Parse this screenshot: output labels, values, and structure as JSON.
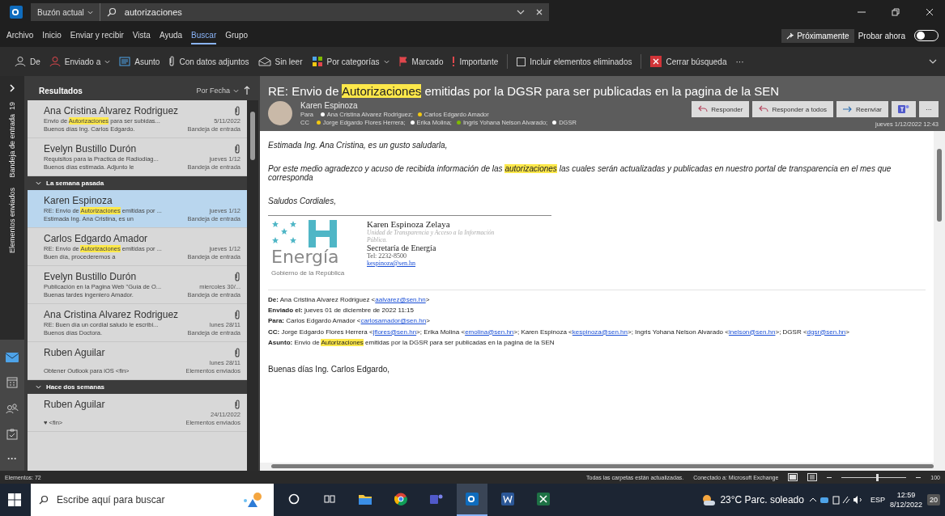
{
  "title_bar": {
    "scope": "Buzón actual",
    "search_value": "autorizaciones"
  },
  "menu_tabs": [
    {
      "label": "Archivo",
      "selected": false
    },
    {
      "label": "Inicio",
      "selected": false
    },
    {
      "label": "Enviar y recibir",
      "selected": false
    },
    {
      "label": "Vista",
      "selected": false
    },
    {
      "label": "Ayuda",
      "selected": false
    },
    {
      "label": "Buscar",
      "selected": true
    },
    {
      "label": "Grupo",
      "selected": false
    }
  ],
  "coming_soon": "Próximamente",
  "try_now": {
    "label": "Probar ahora",
    "on": false
  },
  "ribbon": [
    {
      "kind": "button",
      "label": "De",
      "dropdown": false
    },
    {
      "kind": "button",
      "label": "Enviado a",
      "dropdown": true
    },
    {
      "kind": "button",
      "label": "Asunto",
      "dropdown": false
    },
    {
      "kind": "button",
      "label": "Con datos adjuntos",
      "dropdown": false
    },
    {
      "kind": "button",
      "label": "Sin leer",
      "dropdown": false
    },
    {
      "kind": "button",
      "label": "Por categorías",
      "dropdown": true
    },
    {
      "kind": "button",
      "label": "Marcado",
      "dropdown": false
    },
    {
      "kind": "button",
      "label": "Importante",
      "dropdown": false
    },
    {
      "kind": "checkbox",
      "label": "Incluir elementos eliminados",
      "checked": false
    },
    {
      "kind": "button",
      "label": "Cerrar búsqueda",
      "dropdown": false
    },
    {
      "kind": "more",
      "label": "···"
    }
  ],
  "nav": {
    "folders": [
      {
        "label": "Bandeja de entrada",
        "count": "19"
      },
      {
        "label": "Elementos enviados"
      }
    ],
    "apps": [
      {
        "selected": true
      },
      {
        "selected": false
      },
      {
        "selected": false
      },
      {
        "selected": false
      }
    ],
    "more": "···"
  },
  "mail_list": {
    "heading": "Resultados",
    "sort": "Por Fecha",
    "items": [
      {
        "kind": "mail",
        "sender": "Ana Cristina Alvarez Rodriguez",
        "subject": [
          {
            "text": "Envio de "
          },
          {
            "text": "Autorizaciones",
            "highlight": true
          },
          {
            "text": " para ser subidas..."
          }
        ],
        "date": "5/11/2022",
        "preview": "Buenos días Ing. Carlos Edgardo.",
        "folder": "Bandeja de entrada",
        "attachment": true,
        "selected": false
      },
      {
        "kind": "mail",
        "sender": "Evelyn Bustillo Durón",
        "subject": [
          {
            "text": "Requisitos para la Practica de Radiodiag..."
          }
        ],
        "date": "jueves 1/12",
        "preview": "Buenos días estimada.  Adjunto le",
        "folder": "Bandeja de entrada",
        "attachment": true,
        "selected": false
      },
      {
        "kind": "header",
        "label": "La semana pasada"
      },
      {
        "kind": "mail",
        "sender": "Karen Espinoza",
        "subject": [
          {
            "text": "RE: Envio de "
          },
          {
            "text": "Autorizaciones",
            "highlight": true
          },
          {
            "text": " emitidas por ..."
          }
        ],
        "date": "jueves 1/12",
        "preview": "Estimada Ing. Ana Cristina, es un",
        "folder": "Bandeja de entrada",
        "attachment": false,
        "selected": true
      },
      {
        "kind": "mail",
        "sender": "Carlos Edgardo Amador",
        "subject": [
          {
            "text": "RE: Envio de "
          },
          {
            "text": "Autorizaciones",
            "highlight": true
          },
          {
            "text": " emitidas por ..."
          }
        ],
        "date": "jueves 1/12",
        "preview": "Buen día, procederemos a",
        "folder": "Bandeja de entrada",
        "attachment": false,
        "selected": false
      },
      {
        "kind": "mail",
        "sender": "Evelyn Bustillo Durón",
        "subject": [
          {
            "text": "Publicación en la Pagina Web \"Guía de O..."
          }
        ],
        "date": "miercoles 30/...",
        "preview": "Buenas tardes ingeniero Amador.",
        "folder": "Bandeja de entrada",
        "attachment": true,
        "selected": false
      },
      {
        "kind": "mail",
        "sender": "Ana Cristina Alvarez Rodriguez",
        "subject": [
          {
            "text": "RE: Buen día un cordial saludo le escribi..."
          }
        ],
        "date": "lunes 28/11",
        "preview": "Buenos días Doctora.",
        "folder": "Bandeja de entrada",
        "attachment": true,
        "selected": false
      },
      {
        "kind": "mail",
        "sender": "Ruben Aguilar",
        "date": "lunes 28/11",
        "preview": "Obtener Outlook para iOS <fin>",
        "folder": "Elementos enviados",
        "attachment": true,
        "selected": false
      },
      {
        "kind": "header",
        "label": "Hace dos semanas"
      },
      {
        "kind": "mail",
        "sender": "Ruben Aguilar",
        "date": "24/11/2022",
        "preview": "♥ <fin>",
        "folder": "Elementos enviados",
        "attachment": true,
        "selected": false
      }
    ]
  },
  "message": {
    "title": [
      {
        "text": "RE: Envio de "
      },
      {
        "text": "Autorizaciones",
        "highlight": true
      },
      {
        "text": " emitidas por la DGSR para ser publicadas en la pagina de la SEN"
      }
    ],
    "sender": "Karen Espinoza",
    "to_label": "Para",
    "to": [
      {
        "name": "Ana Cristina Alvarez Rodriguez;",
        "color": "#ffffff"
      },
      {
        "name": "Carlos Edgardo Amador",
        "color": "#f2c811"
      }
    ],
    "cc_label": "CC",
    "cc": [
      {
        "name": "Jorge Edgardo Flores Herrera;",
        "color": "#f2c811"
      },
      {
        "name": "Erika Molina;",
        "color": "#ffffff"
      },
      {
        "name": "Ingris Yohana Nelson Alvarado;",
        "color": "#7fba00"
      },
      {
        "name": "DGSR",
        "color": "#ffffff"
      }
    ],
    "actions": [
      "Responder",
      "Responder a todos",
      "Reenviar"
    ],
    "more": "···",
    "date": "jueves 1/12/2022 12:43",
    "paragraphs": [
      [
        {
          "text": "Estimada Ing. Ana Cristina, es un gusto saludarla,"
        }
      ],
      [
        {
          "text": "Por este medio agradezco y acuso de recibida información de las "
        },
        {
          "text": "autorizaciones",
          "highlight": true
        },
        {
          "text": " las cuales serán actualizadas y publicadas en nuestro portal de transparencia en el mes que corresponda"
        }
      ],
      [
        {
          "text": "Saludos Cordiales,"
        }
      ]
    ],
    "signature": {
      "logo_word": "Energía",
      "logo_caption": "Gobierno de la República",
      "name": "Karen Espinoza Zelaya",
      "unit": "Unidad de Transparencia y Acceso a la Información Pública.",
      "office": "Secretaría de Energía",
      "phone": "Tel: 2232-8500",
      "email": "kespinoza@sen.hn"
    },
    "quoted_headers": [
      {
        "label": "De:",
        "parts": [
          {
            "text": "Ana Cristina Alvarez Rodriguez <"
          },
          {
            "text": "aalvarez@sen.hn",
            "link": true
          },
          {
            "text": ">"
          }
        ]
      },
      {
        "label": "Enviado el:",
        "parts": [
          {
            "text": "jueves 01 de diciembre de 2022 11:15"
          }
        ]
      },
      {
        "label": "Para:",
        "parts": [
          {
            "text": "Carlos Edgardo Amador <"
          },
          {
            "text": "carlosamador@sen.hn",
            "link": true
          },
          {
            "text": ">"
          }
        ]
      },
      {
        "label": "CC:",
        "parts": [
          {
            "text": "Jorge Edgardo Flores Herrera <"
          },
          {
            "text": "jflores@sen.hn",
            "link": true
          },
          {
            "text": ">; Erika Molina <"
          },
          {
            "text": "emolina@sen.hn",
            "link": true
          },
          {
            "text": ">; Karen Espinoza <"
          },
          {
            "text": "kespinoza@sen.hn",
            "link": true
          },
          {
            "text": ">; Ingris Yohana Nelson Alvarado <"
          },
          {
            "text": "inelson@sen.hn",
            "link": true
          },
          {
            "text": ">; DGSR <"
          },
          {
            "text": "dgsr@sen.hn",
            "link": true
          },
          {
            "text": ">"
          }
        ]
      },
      {
        "label": "Asunto:",
        "parts": [
          {
            "text": "Envio de "
          },
          {
            "text": "Autorizaciones",
            "highlight": true
          },
          {
            "text": " emitidas por la DGSR para ser publicadas en la pagina de la SEN"
          }
        ]
      }
    ],
    "greeting": "Buenas días Ing. Carlos Edgardo,"
  },
  "status_bar": {
    "items_count": "Elementos: 72",
    "sync": "Todas las carpetas están actualizadas.",
    "connection": "Conectado a: Microsoft Exchange",
    "zoom": {
      "level": 0.55
    },
    "zoom_label": "100"
  },
  "taskbar": {
    "search_placeholder": "Escribe aquí para buscar",
    "apps": [
      {
        "selected": false
      },
      {
        "selected": false
      },
      {
        "selected": false
      },
      {
        "selected": false
      },
      {
        "selected": false
      },
      {
        "selected": true
      },
      {
        "selected": false
      },
      {
        "selected": false
      }
    ],
    "weather": "23°C  Parc. soleado",
    "language": "ESP",
    "time": "12:59",
    "date": "8/12/2022",
    "notifications": "20"
  }
}
